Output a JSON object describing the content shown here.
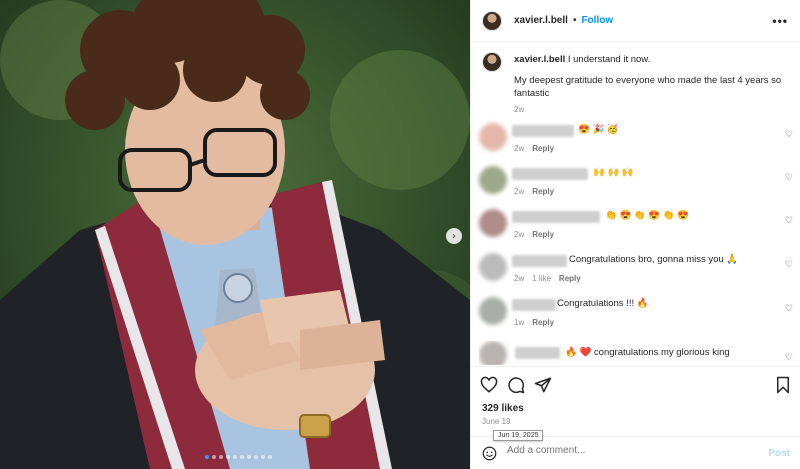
{
  "post": {
    "username": "xavier.l.bell",
    "follow_label": "Follow",
    "separator": "•",
    "more_label": "•••",
    "caption_line1": "I understand it now.",
    "caption_line2": "My deepest gratitude to everyone who made the last 4 years so fantastic",
    "caption_time": "2w",
    "likes": "329 likes",
    "date": "June 19",
    "date_tooltip": "Jun 19, 2025",
    "carousel_next": "›"
  },
  "comments": [
    {
      "text": "😍 🎉 🥳",
      "time": "2w",
      "likes": "",
      "reply": "Reply"
    },
    {
      "text": "🙌 🙌 🙌",
      "time": "2w",
      "likes": "",
      "reply": "Reply"
    },
    {
      "text": "👏 😍 👏 😍 👏 😍",
      "time": "2w",
      "likes": "",
      "reply": "Reply"
    },
    {
      "text": "Congratulations bro, gonna miss you 🙏",
      "time": "2w",
      "likes": "1 like",
      "reply": "Reply"
    },
    {
      "text": "Congratulations !!! 🔥",
      "time": "1w",
      "likes": "",
      "reply": "Reply"
    },
    {
      "text": "🔥 ❤️ congratulations my glorious king",
      "time": "",
      "likes": "",
      "reply": ""
    }
  ],
  "add_comment": {
    "placeholder": "Add a comment...",
    "post_label": "Post"
  },
  "icons": {
    "like": "heart-icon",
    "comment": "comment-icon",
    "share": "share-icon",
    "save": "bookmark-icon",
    "emoji": "emoji-icon"
  }
}
